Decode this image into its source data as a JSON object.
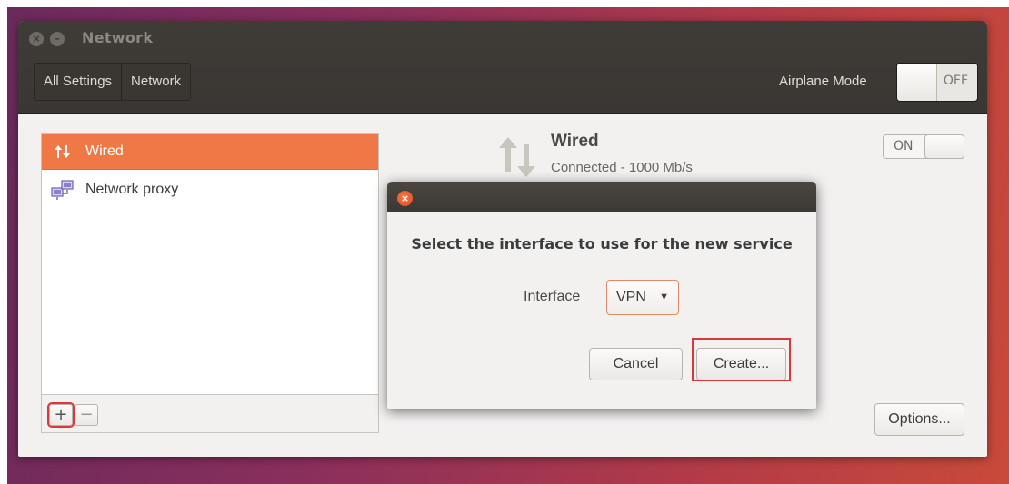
{
  "window": {
    "title": "Network"
  },
  "header": {
    "breadcrumbs": [
      "All Settings",
      "Network"
    ],
    "airplane_mode": {
      "label": "Airplane Mode",
      "state": "OFF"
    }
  },
  "device_list": {
    "items": [
      {
        "label": "Wired",
        "icon": "network-wired-icon",
        "selected": true
      },
      {
        "label": "Network proxy",
        "icon": "network-proxy-icon",
        "selected": false
      }
    ],
    "add_label": "+",
    "remove_label": "−"
  },
  "detail": {
    "name": "Wired",
    "status": "Connected - 1000 Mb/s",
    "switch_state": "ON",
    "options_label": "Options..."
  },
  "dialog": {
    "heading": "Select the interface to use for the new service",
    "interface_label": "Interface",
    "interface_value": "VPN",
    "cancel_label": "Cancel",
    "create_label": "Create..."
  },
  "colors": {
    "accent": "#f07746",
    "highlight": "#d9383a",
    "titlebar": "#3c3935"
  }
}
